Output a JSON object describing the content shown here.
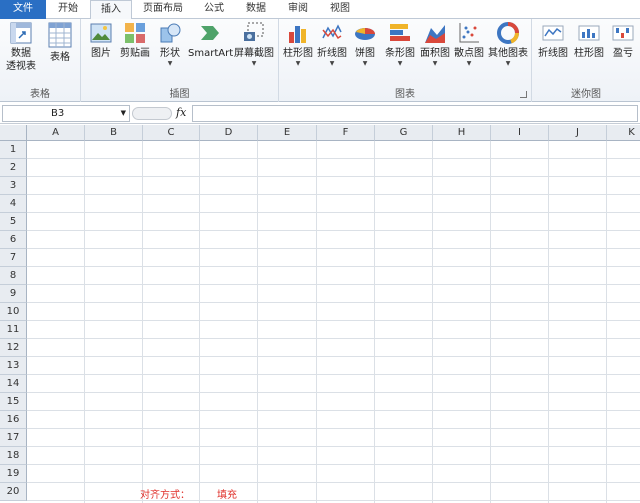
{
  "tabs": [
    "文件",
    "开始",
    "插入",
    "页面布局",
    "公式",
    "数据",
    "审阅",
    "视图"
  ],
  "active_tab": "插入",
  "ribbon": {
    "groups": {
      "table": "表格",
      "illustrations": "插图",
      "charts": "图表",
      "sparklines": "迷你图"
    },
    "buttons": {
      "pivot_line1": "数据",
      "pivot_line2": "透视表",
      "table": "表格",
      "picture": "图片",
      "clipart": "剪贴画",
      "shapes": "形状",
      "smartart": "SmartArt",
      "screenshot": "屏幕截图",
      "column_chart": "柱形图",
      "line_chart": "折线图",
      "pie_chart": "饼图",
      "bar_chart": "条形图",
      "area_chart": "面积图",
      "scatter_chart": "散点图",
      "other_charts": "其他图表",
      "spark_line": "折线图",
      "spark_column": "柱形图",
      "spark_winloss": "盈亏"
    }
  },
  "formula_bar": {
    "name_box": "B3",
    "fx": "fx",
    "formula": ""
  },
  "grid": {
    "columns": [
      "A",
      "B",
      "C",
      "D",
      "E",
      "F",
      "G",
      "H",
      "I",
      "J",
      "K"
    ],
    "rows": [
      "1",
      "2",
      "3",
      "4",
      "5",
      "6",
      "7",
      "8",
      "9",
      "10",
      "11",
      "12",
      "13",
      "14",
      "15",
      "16",
      "17",
      "18",
      "19",
      "20"
    ],
    "cells": {
      "C20": "对齐方式：",
      "D20": "填充"
    }
  },
  "colors": {
    "file_tab": "#2a6fc4",
    "cell_text": "#e0302a",
    "header_bg": "#e8ecf1"
  }
}
